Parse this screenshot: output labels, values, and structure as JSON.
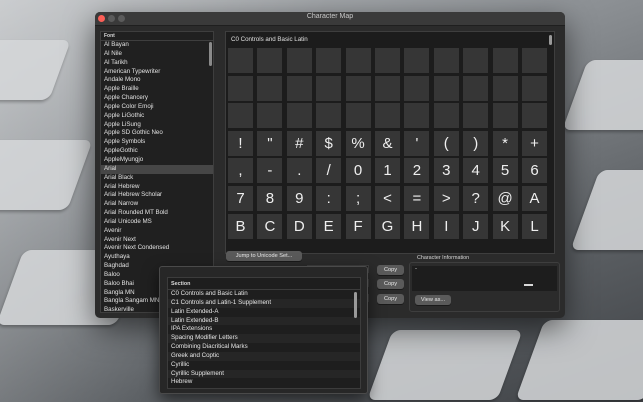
{
  "window": {
    "title": "Character Map"
  },
  "font_list": {
    "header": "Font",
    "items": [
      "Al Bayan",
      "Al Nile",
      "Al Tarikh",
      "American Typewriter",
      "Andale Mono",
      "Apple Braille",
      "Apple Chancery",
      "Apple Color Emoji",
      "Apple LiGothic",
      "Apple LiSung",
      "Apple SD Gothic Neo",
      "Apple Symbols",
      "AppleGothic",
      "AppleMyungjo",
      "Arial",
      "Arial Black",
      "Arial Hebrew",
      "Arial Hebrew Scholar",
      "Arial Narrow",
      "Arial Rounded MT Bold",
      "Arial Unicode MS",
      "Avenir",
      "Avenir Next",
      "Avenir Next Condensed",
      "Ayuthaya",
      "Baghdad",
      "Baloo",
      "Baloo Bhai",
      "Bangla MN",
      "Bangla Sangam MN",
      "Baskerville"
    ],
    "selected_index": 14
  },
  "glyph_panel": {
    "section_title": "C0 Controls and Basic Latin",
    "columns": 11,
    "empty_rows": 3,
    "glyphs": [
      "!",
      "\"",
      "#",
      "$",
      "%",
      "&",
      "'",
      "(",
      ")",
      "*",
      "+",
      ",",
      "-",
      ".",
      "/",
      "0",
      "1",
      "2",
      "3",
      "4",
      "5",
      "6",
      "7",
      "8",
      "9",
      ":",
      ";",
      "<",
      "=",
      ">",
      "?",
      "@",
      "A",
      "B",
      "C",
      "D",
      "E",
      "F",
      "G",
      "H",
      "I",
      "J",
      "K",
      "L"
    ]
  },
  "controls": {
    "jump_label": "Jump to Unicode Set...",
    "copy_label": "Copy",
    "view_as_label": "View as..."
  },
  "char_info": {
    "title": "Character Information",
    "value": "-",
    "glyph": "-"
  },
  "section_popup": {
    "header": "Section",
    "items": [
      "C0 Controls and Basic Latin",
      "C1 Controls and Latin-1 Supplement",
      "Latin Extended-A",
      "Latin Extended-B",
      "IPA Extensions",
      "Spacing Modifier Letters",
      "Combining Diacritical Marks",
      "Greek and Coptic",
      "Cyrillic",
      "Cyrillic Supplement",
      "Hebrew"
    ]
  }
}
